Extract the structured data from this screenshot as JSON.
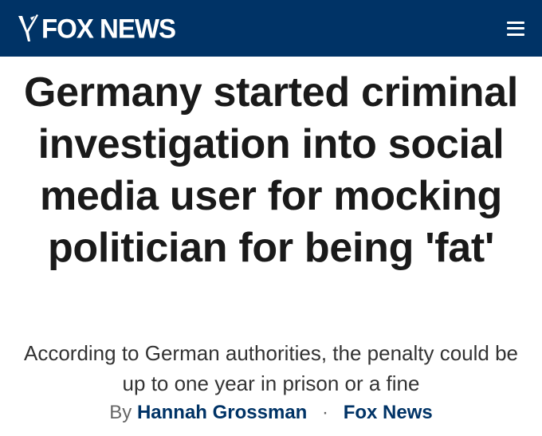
{
  "header": {
    "logo_text": "FOX NEWS",
    "logo_icon": "fox-news-logo-icon",
    "menu_icon": "hamburger-menu-icon",
    "background_color": "#003366"
  },
  "article": {
    "headline": "Germany started criminal investigation into social media user for mocking politician for being 'fat'",
    "subheadline": "According to German authorities, the penalty could be up to one year in prison or a fine",
    "byline": {
      "prefix": "By",
      "author": "Hannah Grossman",
      "separator": "·",
      "source": "Fox News"
    }
  },
  "colors": {
    "brand_navy": "#003366",
    "text_dark": "#1a1a1a",
    "text_gray": "#333333"
  }
}
